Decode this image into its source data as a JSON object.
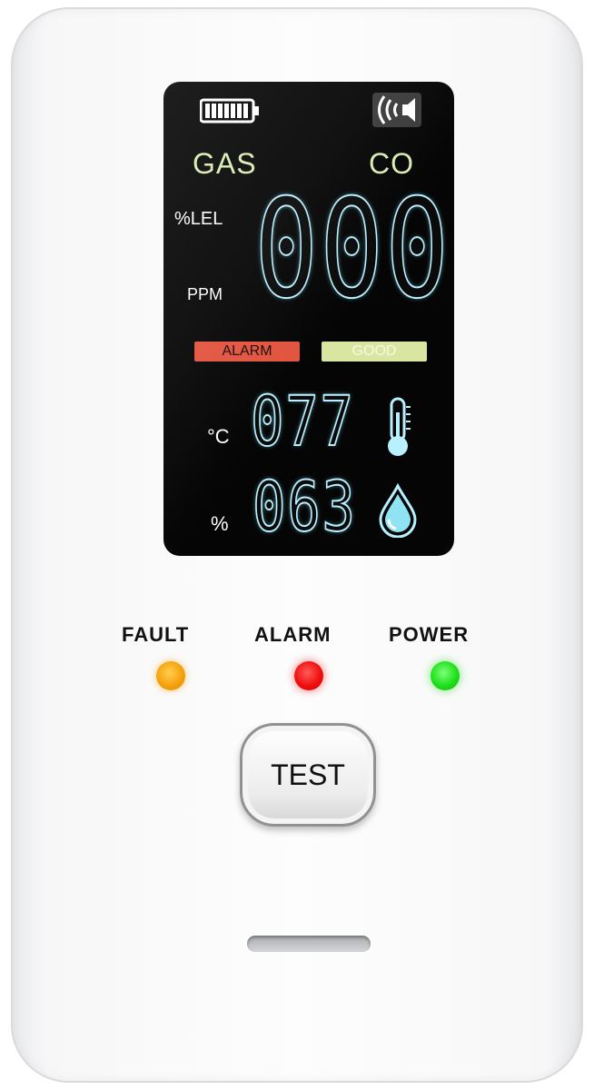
{
  "display": {
    "gas_label": "GAS",
    "co_label": "CO",
    "lel_unit": "%LEL",
    "ppm_unit": "PPM",
    "gas_reading": "000",
    "alarm_badge": "ALARM",
    "good_badge": "GOOD",
    "temperature": "077",
    "temperature_unit": "°C",
    "humidity": "063",
    "humidity_unit": "%",
    "icons": [
      "battery-icon",
      "speaker-icon",
      "thermometer-icon",
      "water-drop-icon"
    ],
    "badge_colors": {
      "alarm": "#e2543f",
      "good": "#d8e6a1"
    },
    "digit_color": "#b9f0ff"
  },
  "indicators": [
    {
      "label": "FAULT",
      "color": "#f5a10e"
    },
    {
      "label": "ALARM",
      "color": "#f01010"
    },
    {
      "label": "POWER",
      "color": "#1fe01a"
    }
  ],
  "controls": {
    "test_label": "TEST"
  }
}
